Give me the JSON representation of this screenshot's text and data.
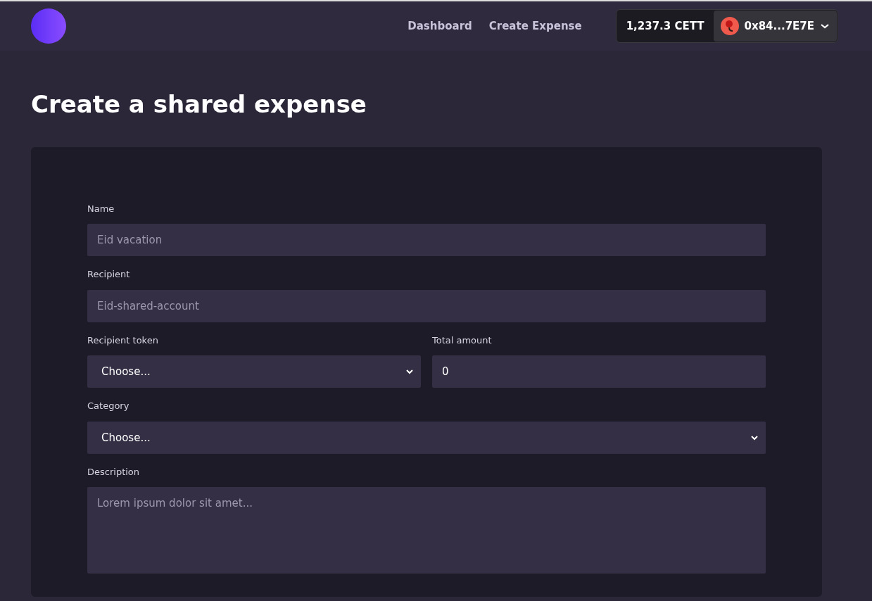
{
  "nav": {
    "links": [
      {
        "label": "Dashboard"
      },
      {
        "label": "Create Expense"
      }
    ],
    "wallet": {
      "balance": "1,237.3 CETT",
      "address": "0x84...7E7E"
    }
  },
  "page_title": "Create a shared expense",
  "form": {
    "rows": [
      [
        {
          "kind": "text",
          "label": "Name",
          "placeholder": "Eid vacation"
        }
      ],
      [
        {
          "kind": "text",
          "label": "Recipient",
          "placeholder": "Eid-shared-account"
        }
      ],
      [
        {
          "kind": "select",
          "label": "Recipient token",
          "value": "Choose..."
        },
        {
          "kind": "text",
          "label": "Total amount",
          "value": "0"
        }
      ],
      [
        {
          "kind": "select",
          "label": "Category",
          "value": "Choose..."
        }
      ],
      [
        {
          "kind": "textarea",
          "label": "Description",
          "placeholder": "Lorem ipsum dolor sit amet..."
        }
      ]
    ]
  }
}
